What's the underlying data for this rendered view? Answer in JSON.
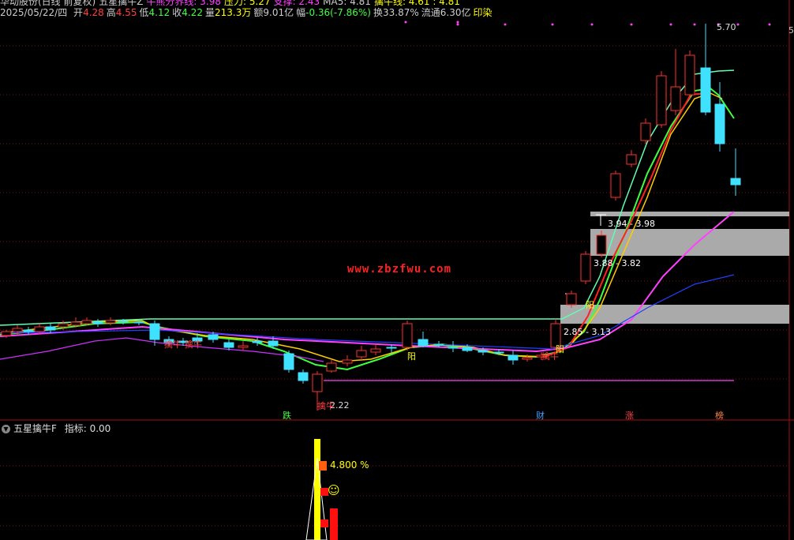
{
  "header": {
    "line1": [
      {
        "text": "华动股份(日线 前复权)",
        "color": "#cccccc"
      },
      {
        "text": "五星擒牛Z",
        "color": "#cccccc"
      },
      {
        "text": "牛熊分界线: 3.98",
        "color": "#ff40ff"
      },
      {
        "text": "压力: 5.27",
        "color": "#ffff00"
      },
      {
        "text": "支撑: 2.43",
        "color": "#ff40ff"
      },
      {
        "text": "MA5: 4.81",
        "color": "#cccccc"
      },
      {
        "text": "擒牛线: 4.61 : 4.81",
        "color": "#ffff00"
      }
    ],
    "date": "2025/05/22/四",
    "quote": [
      {
        "label": "开",
        "value": "4.28",
        "color": "#ff4040"
      },
      {
        "label": "高",
        "value": "4.55",
        "color": "#ff4040"
      },
      {
        "label": "低",
        "value": "4.12",
        "color": "#40ff40"
      },
      {
        "label": "收",
        "value": "4.22",
        "color": "#40ff40"
      },
      {
        "label": "量",
        "value": "213.3万",
        "color": "#ffff00"
      },
      {
        "label": "额",
        "value": "9.01亿",
        "color": "#cccccc"
      },
      {
        "label": "幅",
        "value": "-0.36(-7.86%)",
        "color": "#40ff40"
      },
      {
        "label": "换",
        "value": "33.87%",
        "color": "#cccccc"
      },
      {
        "label": "流通",
        "value": "6.30亿",
        "color": "#cccccc"
      },
      {
        "label": "印染",
        "value": "",
        "color": "#ffff00"
      }
    ]
  },
  "watermark": "www.zbzfwu.com",
  "annotations": {
    "high_label": "5.70",
    "low_label": "2.22",
    "zone1": "3.94 - 3.98",
    "zone2": "3.88 - 3.82",
    "zone3": "2.85 - 3.13",
    "qinniu_marks": [
      "擒牛",
      "擒牛",
      "擒牛",
      "擒牛"
    ],
    "yang_marks": [
      "阳",
      "阳",
      "阳"
    ],
    "bottom_marks": {
      "die": "跌",
      "cai": "财",
      "zhang": "涨",
      "bang": "榜"
    }
  },
  "sub_indicator": {
    "title": "五星擒牛F",
    "value_label": "指标: 0.00",
    "pct_text": "4.800  %"
  },
  "colors": {
    "up": "#ff3030",
    "down": "#40e0ff",
    "ma_green": "#40ff40",
    "ma_yellow": "#ffcc00",
    "ma_cyan": "#60ffb0",
    "ma_magenta": "#ff40ff",
    "ma_blue": "#2040ff",
    "grid": "#801010"
  }
}
